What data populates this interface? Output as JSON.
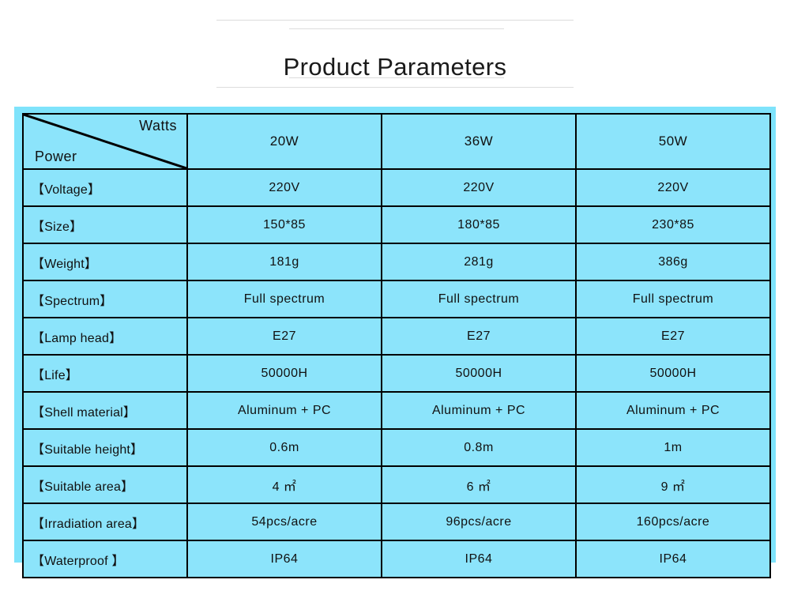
{
  "header": {
    "title": "Product Parameters"
  },
  "table": {
    "corner": {
      "top_right_label": "Watts",
      "bottom_left_label": "Power"
    },
    "column_headers": [
      "20W",
      "36W",
      "50W"
    ],
    "rows": [
      {
        "label": "【Voltage】",
        "values": [
          "220V",
          "220V",
          "220V"
        ]
      },
      {
        "label": "【Size】",
        "values": [
          "150*85",
          "180*85",
          "230*85"
        ]
      },
      {
        "label": "【Weight】",
        "values": [
          "181g",
          "281g",
          "386g"
        ]
      },
      {
        "label": "【Spectrum】",
        "values": [
          "Full spectrum",
          "Full spectrum",
          "Full spectrum"
        ]
      },
      {
        "label": "【Lamp head】",
        "values": [
          "E27",
          "E27",
          "E27"
        ]
      },
      {
        "label": "【Life】",
        "values": [
          "50000H",
          "50000H",
          "50000H"
        ]
      },
      {
        "label": "【Shell material】",
        "values": [
          "Aluminum + PC",
          "Aluminum + PC",
          "Aluminum + PC"
        ]
      },
      {
        "label": "【Suitable height】",
        "values": [
          "0.6m",
          "0.8m",
          "1m"
        ]
      },
      {
        "label": "【Suitable area】",
        "values": [
          "4 ㎡",
          "6 ㎡",
          "9 ㎡"
        ]
      },
      {
        "label": "【Irradiation area】",
        "values": [
          "54pcs/acre",
          "96pcs/acre",
          "160pcs/acre"
        ]
      },
      {
        "label": "【Waterproof 】",
        "values": [
          "IP64",
          "IP64",
          "IP64"
        ]
      }
    ]
  },
  "colors": {
    "panel_background": "#7fe3fb",
    "cell_background": "#8ce4fb",
    "border": "#000000",
    "rule": "#dcdcdc",
    "text": "#111111"
  }
}
